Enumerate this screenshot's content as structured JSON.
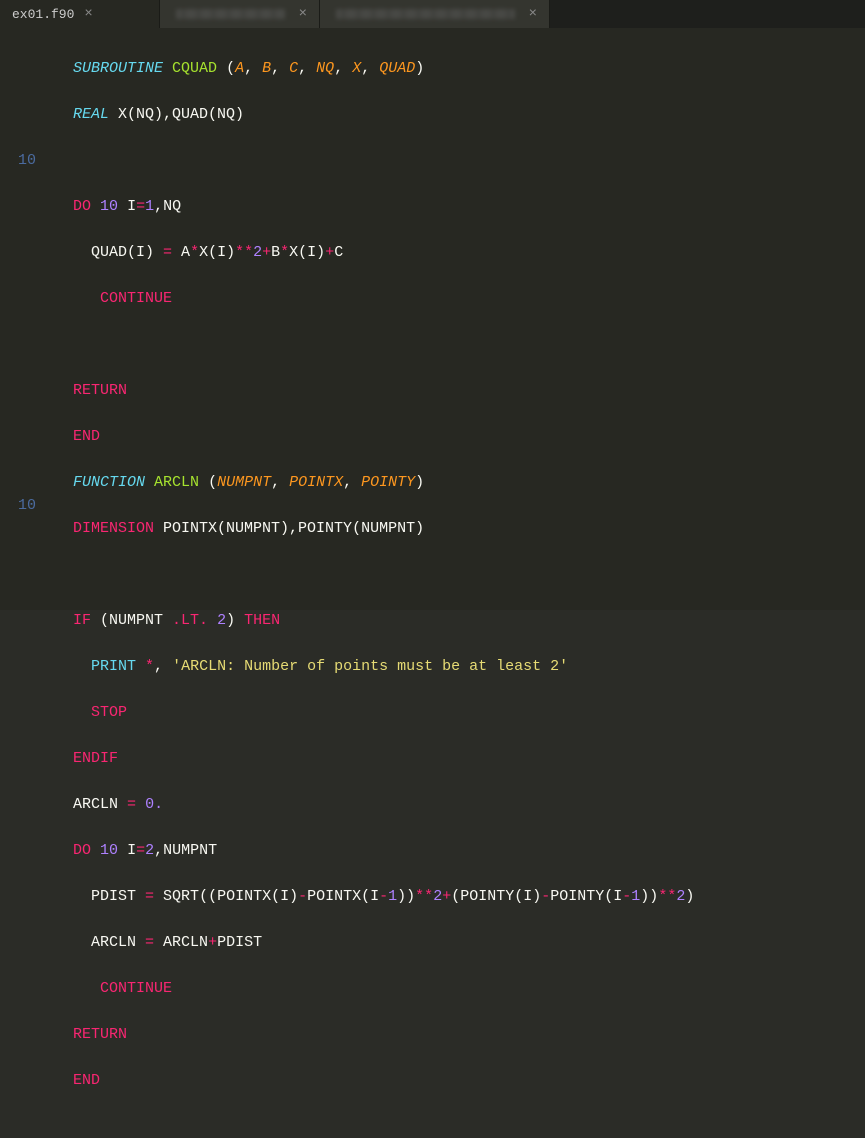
{
  "tabs": [
    {
      "label": "ex01.f90",
      "active": true
    },
    {
      "label": "",
      "active": false
    },
    {
      "label": "",
      "active": false
    }
  ],
  "gutter": {
    "label10_a": "10",
    "label10_b": "10"
  },
  "code": {
    "l1": {
      "sub": "SUBROUTINE",
      "name": "CQUAD",
      "open": " (",
      "a": "A",
      "c1": ", ",
      "b": "B",
      "c2": ", ",
      "c": "C",
      "c3": ", ",
      "nq": "NQ",
      "c4": ", ",
      "x": "X",
      "c5": ", ",
      "quad": "QUAD",
      "close": ")"
    },
    "l2": {
      "real": "REAL",
      "rest": " X(NQ),QUAD(NQ)"
    },
    "l4": {
      "do": "DO",
      "sp": " ",
      "ten": "10",
      "rest1": " I",
      "eq": "=",
      "one": "1",
      "rest2": ",NQ"
    },
    "l5": {
      "lead": "  QUAD(I) ",
      "eq": "=",
      "sp": " A",
      "st1": "*",
      "x1": "X(I)",
      "pw": "**",
      "two": "2",
      "pl1": "+",
      "b": "B",
      "st2": "*",
      "x2": "X(I)",
      "pl2": "+",
      "c": "C"
    },
    "l6": {
      "cont": "CONTINUE"
    },
    "l8": {
      "ret": "RETURN"
    },
    "l9": {
      "end": "END"
    },
    "l10": {
      "func": "FUNCTION",
      "name": "ARCLN",
      "open": " (",
      "p1": "NUMPNT",
      "c1": ", ",
      "p2": "POINTX",
      "c2": ", ",
      "p3": "POINTY",
      "close": ")"
    },
    "l11": {
      "dim": "DIMENSION",
      "rest": " POINTX(NUMPNT),POINTY(NUMPNT)"
    },
    "l13": {
      "if": "IF",
      "open": " (NUMPNT ",
      "lt": ".LT.",
      "sp": " ",
      "two": "2",
      "close": ") ",
      "then": "THEN"
    },
    "l14": {
      "print": "PRINT",
      "star": " *",
      "comma": ", ",
      "str": "'ARCLN: Number of points must be at least 2'"
    },
    "l15": {
      "stop": "STOP"
    },
    "l16": {
      "endif": "ENDIF"
    },
    "l17": {
      "lhs": "ARCLN ",
      "eq": "=",
      "sp": " ",
      "zero": "0.",
      "after": ""
    },
    "l18": {
      "do": "DO",
      "sp": " ",
      "ten": "10",
      "rest1": " I",
      "eq": "=",
      "two": "2",
      "rest2": ",NUMPNT"
    },
    "l19": {
      "lhs": "  PDIST ",
      "eq": "=",
      "sqrt": " SQRT",
      "open": "((POINTX(I)",
      "mn1": "-",
      "px": "POINTX(I",
      "mn2": "-",
      "one1": "1",
      "cl1": "))",
      "pw1": "**",
      "two1": "2",
      "pl": "+",
      "op2": "(POINTY(I)",
      "mn3": "-",
      "py": "POINTY(I",
      "mn4": "-",
      "one2": "1",
      "cl2": "))",
      "pw2": "**",
      "two2": "2",
      "close": ")"
    },
    "l20": {
      "lhs": "  ARCLN ",
      "eq": "=",
      "rhs": " ARCLN",
      "pl": "+",
      "pd": "PDIST"
    },
    "l21": {
      "cont": "CONTINUE"
    },
    "l22": {
      "ret": "RETURN"
    },
    "l23": {
      "end": "END"
    }
  }
}
